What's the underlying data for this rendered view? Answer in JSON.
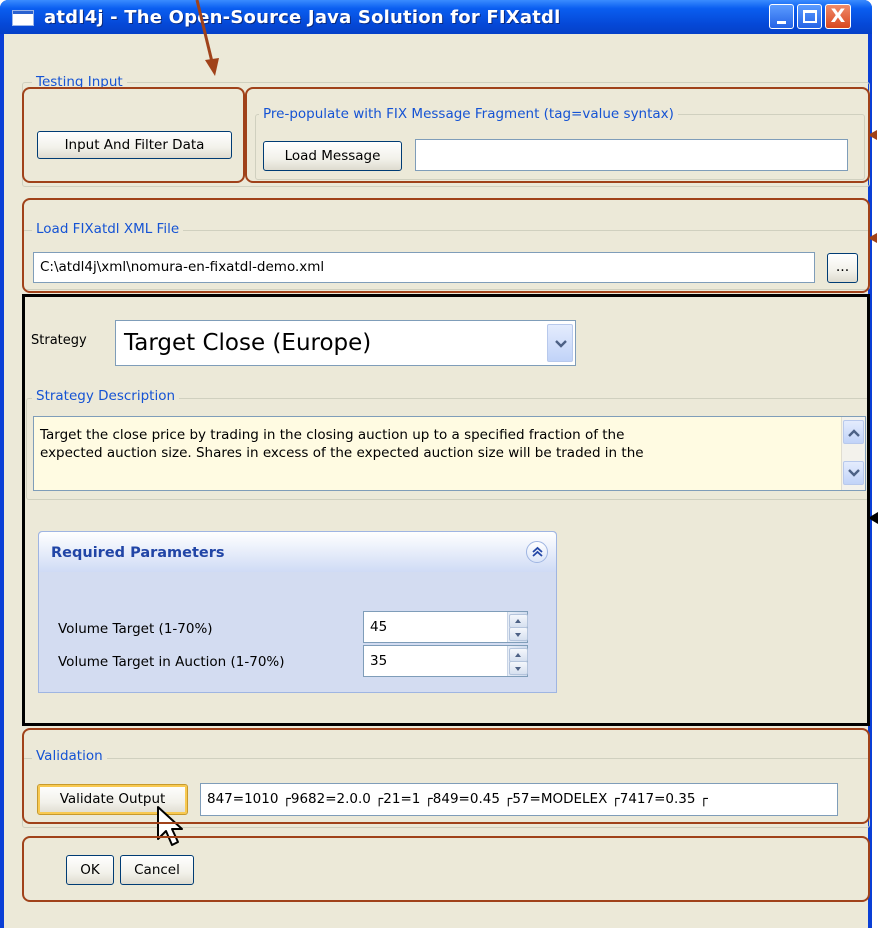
{
  "window": {
    "title": "atdl4j - The Open-Source Java Solution for FIXatdl",
    "min_label": "_",
    "max_label": "□",
    "close_label": "X"
  },
  "testing_input": {
    "legend": "Testing Input",
    "input_filter_button": "Input And Filter Data",
    "prepopulate_legend": "Pre-populate with FIX Message Fragment (tag=value syntax)",
    "load_message_button": "Load Message",
    "message_value": ""
  },
  "load_file": {
    "legend": "Load FIXatdl XML File",
    "path_value": "C:\\atdl4j\\xml\\nomura-en-fixatdl-demo.xml",
    "browse_button": "..."
  },
  "strategy": {
    "label": "Strategy",
    "selected": "Target Close (Europe)",
    "description_legend": "Strategy Description",
    "description_lines": [
      "Target the close price by trading in the closing auction up to a specified fraction of the",
      "expected auction size.  Shares in excess of the expected auction size will be traded in the"
    ]
  },
  "required_parameters": {
    "title": "Required Parameters",
    "params": [
      {
        "label": "Volume Target (1-70%)",
        "value": "45"
      },
      {
        "label": "Volume Target in Auction (1-70%)",
        "value": "35"
      }
    ]
  },
  "validation": {
    "legend": "Validation",
    "validate_button": "Validate Output",
    "output_value": "847=1010 ┌9682=2.0.0 ┌21=1 ┌849=0.45 ┌57=MODELEX ┌7417=0.35 ┌"
  },
  "dialog_buttons": {
    "ok": "OK",
    "cancel": "Cancel"
  },
  "colors": {
    "titlebar": "#0a5ef0",
    "dialog_background": "#ece9d8",
    "legend_text": "#1553d4",
    "annotation": "#a0421a",
    "description_background": "#fffbe2"
  }
}
